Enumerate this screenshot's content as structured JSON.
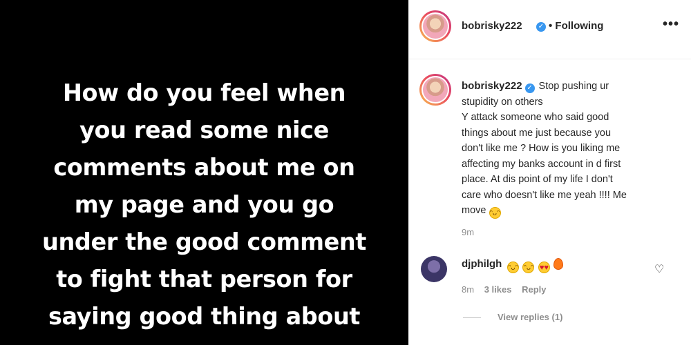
{
  "post": {
    "image_text_lines": [
      "How do you feel when",
      "you read some nice",
      "comments about me on",
      "my page and you go",
      "under the good comment",
      "to fight that person for",
      "saying good thing about"
    ]
  },
  "header": {
    "username": "bobrisky222",
    "following_label": "• Following",
    "more_label": "•••"
  },
  "caption": {
    "username": "bobrisky222",
    "lines": [
      "Stop pushing ur",
      "stupidity on others",
      "Y attack someone who said good",
      "things about me just because you",
      "don't like me ? How is you liking me",
      "affecting my banks account in d first",
      "place. At dis point of my life I don't",
      "care who doesn't like me yeah !!!! Me",
      "move"
    ],
    "time": "9m"
  },
  "comment": {
    "username": "djphilgh",
    "time": "8m",
    "likes": "3 likes",
    "reply_label": "Reply",
    "view_replies": "View replies (1)"
  },
  "icons": [
    "verified-badge-icon",
    "more-options-icon",
    "laughing-emoji-icon",
    "heart-eyes-emoji-icon",
    "fire-emoji-icon",
    "heart-like-icon"
  ],
  "colors": {
    "image_background": "#000000",
    "verified_blue": "#3897f0",
    "secondary_text": "#8e8e8e",
    "primary_text": "#262626"
  }
}
